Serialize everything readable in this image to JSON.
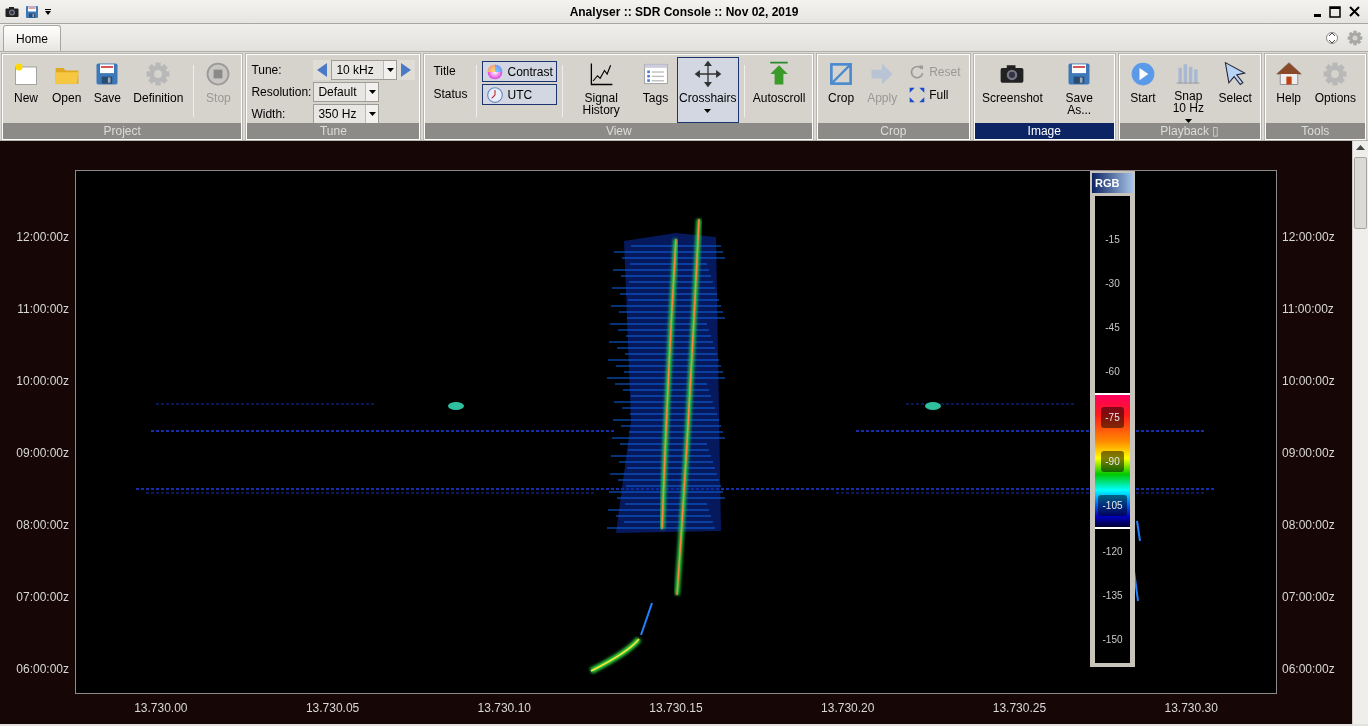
{
  "window": {
    "title": "Analyser :: SDR Console :: Nov 02, 2019"
  },
  "tabs": [
    {
      "label": "Home",
      "selected": true
    }
  ],
  "ribbon": {
    "groups": [
      {
        "label": "Project",
        "highlighted": false,
        "items": [
          {
            "kind": "large",
            "label": "New",
            "disabled": false,
            "selected": false
          },
          {
            "kind": "large",
            "label": "Open",
            "disabled": false,
            "selected": false
          },
          {
            "kind": "large",
            "label": "Save",
            "disabled": false,
            "selected": false
          },
          {
            "kind": "large",
            "label": "Definition",
            "disabled": false,
            "selected": false
          },
          {
            "kind": "separator"
          },
          {
            "kind": "large",
            "label": "Stop",
            "disabled": true,
            "selected": false
          }
        ]
      },
      {
        "label": "Tune",
        "highlighted": false,
        "items": [
          {
            "kind": "stepper",
            "label": "Tune:",
            "value": "10 kHz"
          },
          {
            "kind": "combo",
            "label": "Resolution:",
            "value": "Default"
          },
          {
            "kind": "combo",
            "label": "Width:",
            "value": "350 Hz"
          }
        ]
      },
      {
        "label": "View",
        "highlighted": false,
        "items": [
          {
            "kind": "text",
            "label": "Title"
          },
          {
            "kind": "text",
            "label": "Status"
          },
          {
            "kind": "separator"
          },
          {
            "kind": "toggle",
            "label": "Contrast",
            "selected": true
          },
          {
            "kind": "toggle",
            "label": "UTC",
            "selected": true
          },
          {
            "kind": "separator"
          },
          {
            "kind": "large",
            "label": "Signal History",
            "disabled": false,
            "selected": false
          },
          {
            "kind": "large",
            "label": "Tags",
            "disabled": false,
            "selected": false
          },
          {
            "kind": "large",
            "label": "Crosshairs",
            "disabled": false,
            "selected": true,
            "dropdown": true
          },
          {
            "kind": "separator"
          },
          {
            "kind": "large",
            "label": "Autoscroll",
            "disabled": false,
            "selected": false
          }
        ]
      },
      {
        "label": "Crop",
        "highlighted": false,
        "items": [
          {
            "kind": "large",
            "label": "Crop",
            "disabled": false,
            "selected": false
          },
          {
            "kind": "large",
            "label": "Apply",
            "disabled": true,
            "selected": false
          },
          {
            "kind": "small",
            "label": "Reset",
            "disabled": true
          },
          {
            "kind": "small",
            "label": "Full",
            "disabled": false
          }
        ]
      },
      {
        "label": "Image",
        "highlighted": true,
        "items": [
          {
            "kind": "large",
            "label": "Screenshot",
            "disabled": false,
            "selected": false
          },
          {
            "kind": "large",
            "label": "Save As...",
            "disabled": false,
            "selected": false
          }
        ]
      },
      {
        "label": "Playback ▯",
        "highlighted": false,
        "items": [
          {
            "kind": "large",
            "label": "Start",
            "disabled": false,
            "selected": false
          },
          {
            "kind": "large",
            "label": "Snap",
            "sublabel": "10 Hz",
            "dropdown": true,
            "disabled": false,
            "selected": false
          },
          {
            "kind": "large",
            "label": "Select",
            "disabled": false,
            "selected": false
          }
        ]
      },
      {
        "label": "Tools",
        "highlighted": false,
        "items": [
          {
            "kind": "large",
            "label": "Help",
            "disabled": false,
            "selected": false
          },
          {
            "kind": "large",
            "label": "Options",
            "disabled": false,
            "selected": false
          }
        ]
      }
    ]
  },
  "plot": {
    "y_labels_left": [
      "12:00:00z",
      "11:00:00z",
      "10:00:00z",
      "09:00:00z",
      "08:00:00z",
      "07:00:00z",
      "06:00:00z"
    ],
    "y_labels_right": [
      "12:00:00z",
      "11:00:00z",
      "10:00:00z",
      "09:00:00z",
      "08:00:00z",
      "07:00:00z",
      "06:00:00z"
    ],
    "x_labels": [
      "13.730.00",
      "13.730.05",
      "13.730.10",
      "13.730.15",
      "13.730.20",
      "13.730.25",
      "13.730.30"
    ],
    "color_scale": {
      "title": "RGB",
      "labels": [
        {
          "text": "-15",
          "in_band": false
        },
        {
          "text": "-30",
          "in_band": false
        },
        {
          "text": "-45",
          "in_band": false
        },
        {
          "text": "-60",
          "in_band": false
        },
        {
          "text": "-75",
          "in_band": true
        },
        {
          "text": "-90",
          "in_band": true
        },
        {
          "text": "-105",
          "in_band": true
        },
        {
          "text": "-120",
          "in_band": false
        },
        {
          "text": "-135",
          "in_band": false
        },
        {
          "text": "-150",
          "in_band": false
        }
      ]
    }
  }
}
